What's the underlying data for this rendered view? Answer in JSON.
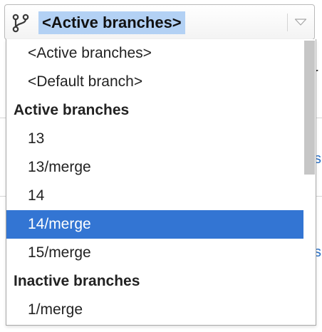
{
  "background": {
    "frag_1": "s",
    "frag_2": "s",
    "frag_3": "r"
  },
  "selector": {
    "icon": "branch-icon",
    "value": "<Active branches>",
    "arrow_icon": "chevron-down-icon"
  },
  "dropdown": {
    "items": [
      {
        "label": "<Active branches>",
        "kind": "option"
      },
      {
        "label": "<Default branch>",
        "kind": "option"
      },
      {
        "label": "Active branches",
        "kind": "header"
      },
      {
        "label": "13",
        "kind": "option"
      },
      {
        "label": "13/merge",
        "kind": "option"
      },
      {
        "label": "14",
        "kind": "option"
      },
      {
        "label": "14/merge",
        "kind": "option",
        "selected": true
      },
      {
        "label": "15/merge",
        "kind": "option"
      },
      {
        "label": "Inactive branches",
        "kind": "header"
      },
      {
        "label": "1/merge",
        "kind": "option"
      }
    ]
  },
  "colors": {
    "selection_highlight": "#3375d3",
    "value_highlight": "#b3d1f4",
    "link": "#2a6fc4"
  }
}
